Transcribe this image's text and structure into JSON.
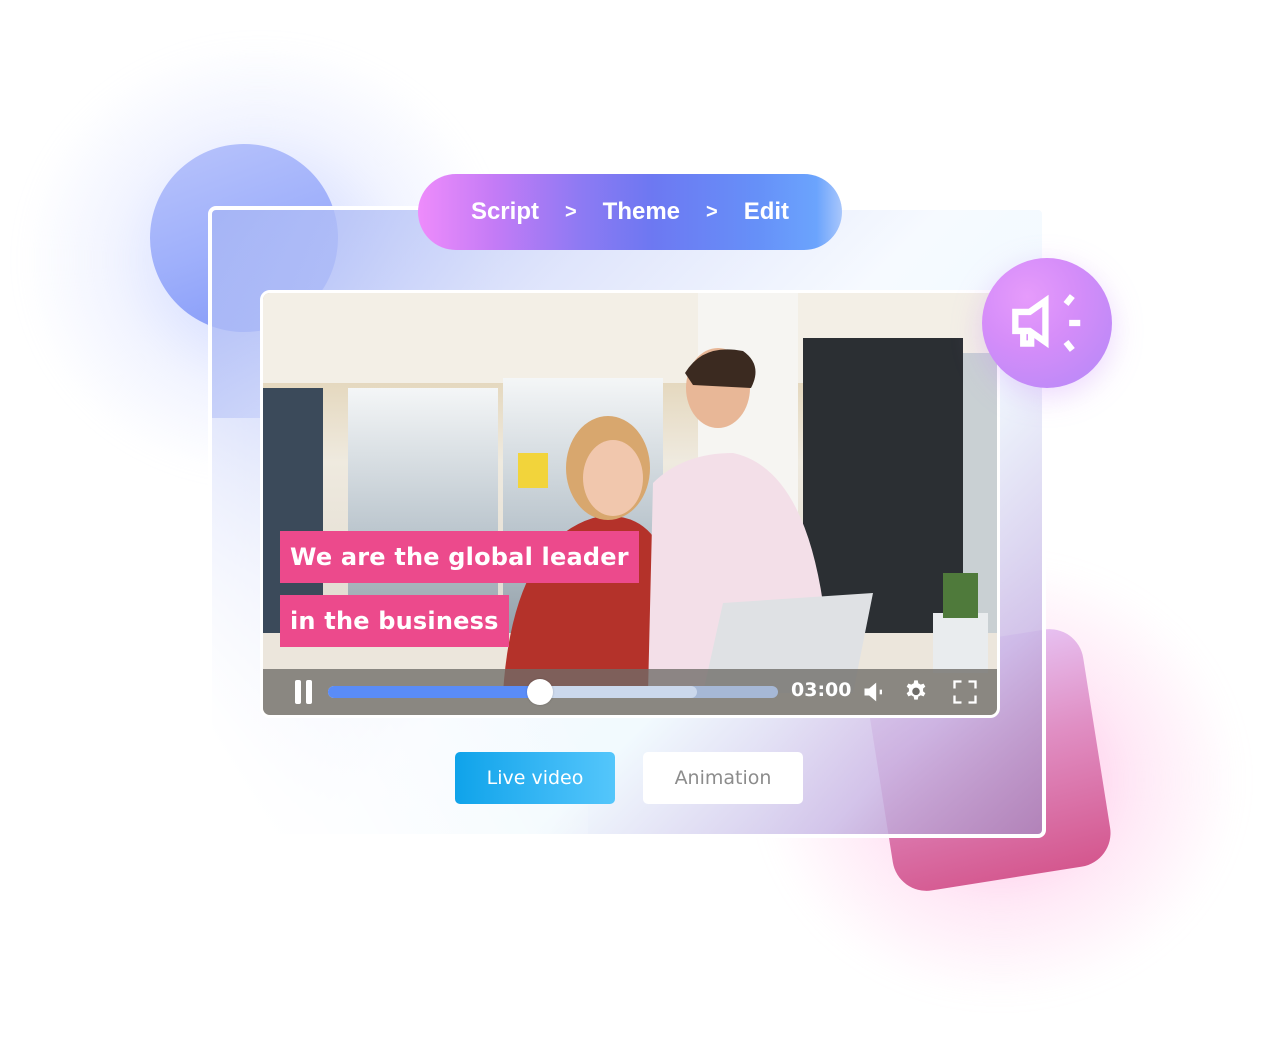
{
  "breadcrumb": {
    "steps": [
      "Script",
      "Theme",
      "Edit"
    ],
    "separator": ">"
  },
  "player": {
    "caption_lines": [
      "We are the global leader",
      "in the business"
    ],
    "time": "03:00",
    "playback_state": "playing",
    "progress_played_fraction": 0.47,
    "progress_buffered_fraction": 0.82,
    "controls": {
      "pause_icon": "pause-icon",
      "volume_icon": "volume-icon",
      "settings_icon": "gear-icon",
      "fullscreen_icon": "fullscreen-icon"
    },
    "scene_description": "Two colleagues in an office looking at a laptop"
  },
  "badge": {
    "icon": "megaphone-icon"
  },
  "mode_toggle": {
    "options": [
      "Live video",
      "Animation"
    ],
    "selected": "Live video"
  },
  "colors": {
    "caption_bg": "#ec4a8c",
    "progress_played": "#5a8cf7",
    "live_button": "#1aa9ee",
    "breadcrumb_start": "#ee8cfb",
    "breadcrumb_end": "#6ba4fd"
  }
}
